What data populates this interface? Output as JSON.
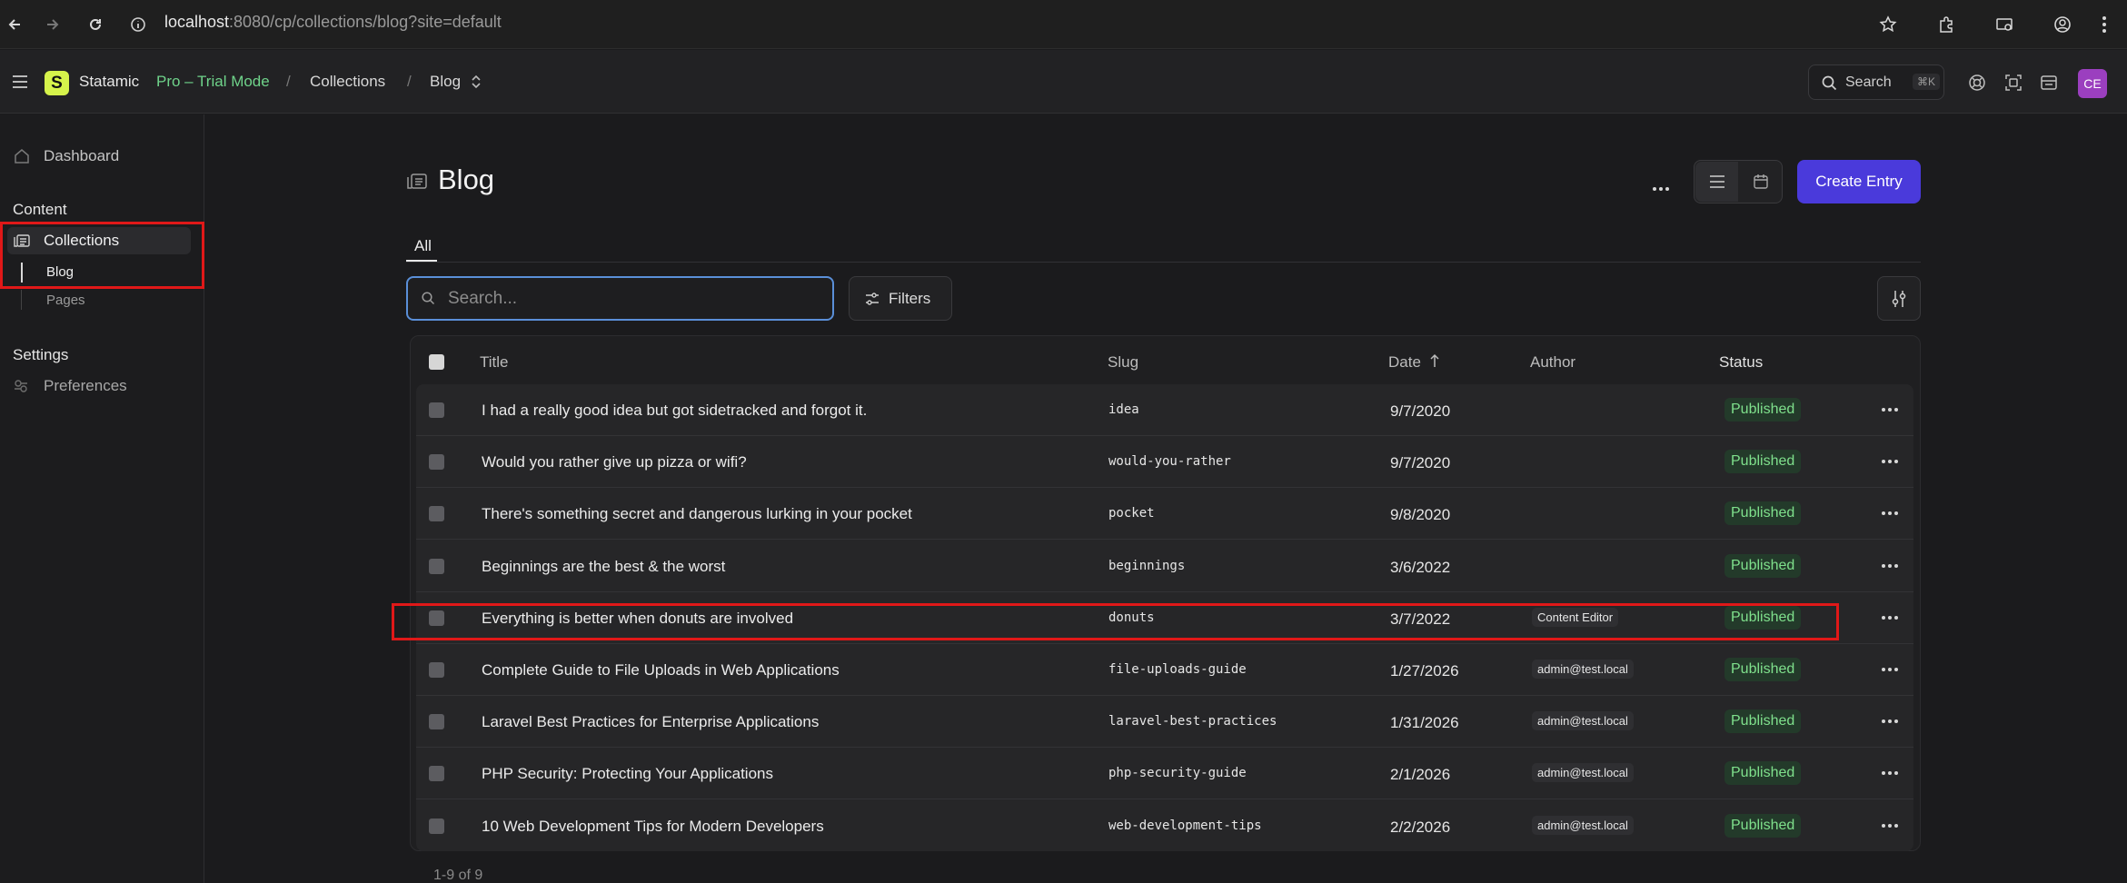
{
  "browser": {
    "url_host": "localhost",
    "url_rest": ":8080/cp/collections/blog?site=default"
  },
  "header": {
    "app_name": "Statamic",
    "logo_letter": "S",
    "trial": "Pro – Trial Mode",
    "crumb_sep": "/",
    "crumb_collections": "Collections",
    "crumb_blog": "Blog",
    "search_label": "Search",
    "search_shortcut": "⌘K",
    "avatar": "CE"
  },
  "sidebar": {
    "dashboard": "Dashboard",
    "content_head": "Content",
    "collections": "Collections",
    "blog": "Blog",
    "pages": "Pages",
    "settings_head": "Settings",
    "preferences": "Preferences"
  },
  "main": {
    "title": "Blog",
    "create_button": "Create Entry",
    "tab_all": "All",
    "search_placeholder": "Search...",
    "filters": "Filters",
    "footer": "1-9 of 9"
  },
  "table": {
    "columns": {
      "title": "Title",
      "slug": "Slug",
      "date": "Date",
      "author": "Author",
      "status": "Status"
    },
    "rows": [
      {
        "title": "I had a really good idea but got sidetracked and forgot it.",
        "slug": "idea",
        "date": "9/7/2020",
        "author": "",
        "status": "Published"
      },
      {
        "title": "Would you rather give up pizza or wifi?",
        "slug": "would-you-rather",
        "date": "9/7/2020",
        "author": "",
        "status": "Published"
      },
      {
        "title": "There's something secret and dangerous lurking in your pocket",
        "slug": "pocket",
        "date": "9/8/2020",
        "author": "",
        "status": "Published"
      },
      {
        "title": "Beginnings are the best & the worst",
        "slug": "beginnings",
        "date": "3/6/2022",
        "author": "",
        "status": "Published"
      },
      {
        "title": "Everything is better when donuts are involved",
        "slug": "donuts",
        "date": "3/7/2022",
        "author": "Content Editor",
        "status": "Published"
      },
      {
        "title": "Complete Guide to File Uploads in Web Applications",
        "slug": "file-uploads-guide",
        "date": "1/27/2026",
        "author": "admin@test.local",
        "status": "Published"
      },
      {
        "title": "Laravel Best Practices for Enterprise Applications",
        "slug": "laravel-best-practices",
        "date": "1/31/2026",
        "author": "admin@test.local",
        "status": "Published"
      },
      {
        "title": "PHP Security: Protecting Your Applications",
        "slug": "php-security-guide",
        "date": "2/1/2026",
        "author": "admin@test.local",
        "status": "Published"
      },
      {
        "title": "10 Web Development Tips for Modern Developers",
        "slug": "web-development-tips",
        "date": "2/2/2026",
        "author": "admin@test.local",
        "status": "Published"
      }
    ]
  },
  "colors": {
    "accent": "#4a3adb",
    "status_published": "#7fe08c",
    "logo": "#d6f34b",
    "highlight": "#e01818"
  }
}
